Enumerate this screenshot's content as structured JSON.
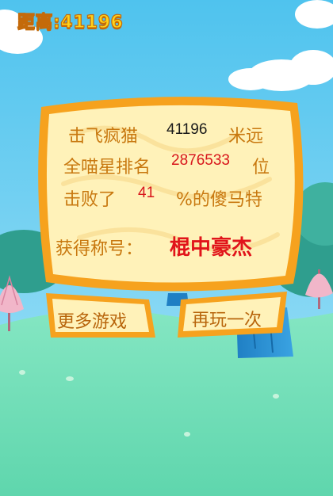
{
  "hud": {
    "distance_label": "距离:",
    "distance_value": "41196"
  },
  "result_panel": {
    "line1": {
      "prefix": "击飞疯猫",
      "value": "41196",
      "suffix": "米远"
    },
    "line2": {
      "prefix": "全喵星排名",
      "value": "2876533",
      "suffix": "位"
    },
    "line3": {
      "prefix": "击败了",
      "value": "41",
      "suffix": "%的傻马特"
    },
    "title_label": "获得称号：",
    "title_value": "棍中豪杰"
  },
  "buttons": {
    "more_games": "更多游戏",
    "play_again": "再玩一次"
  },
  "colors": {
    "sky": "#6fd0f0",
    "grass": "#73e0b8",
    "panel_fill": "#fff2b8",
    "panel_border": "#f5a623",
    "label_text": "#c8780f",
    "highlight_red": "#d8161b"
  }
}
